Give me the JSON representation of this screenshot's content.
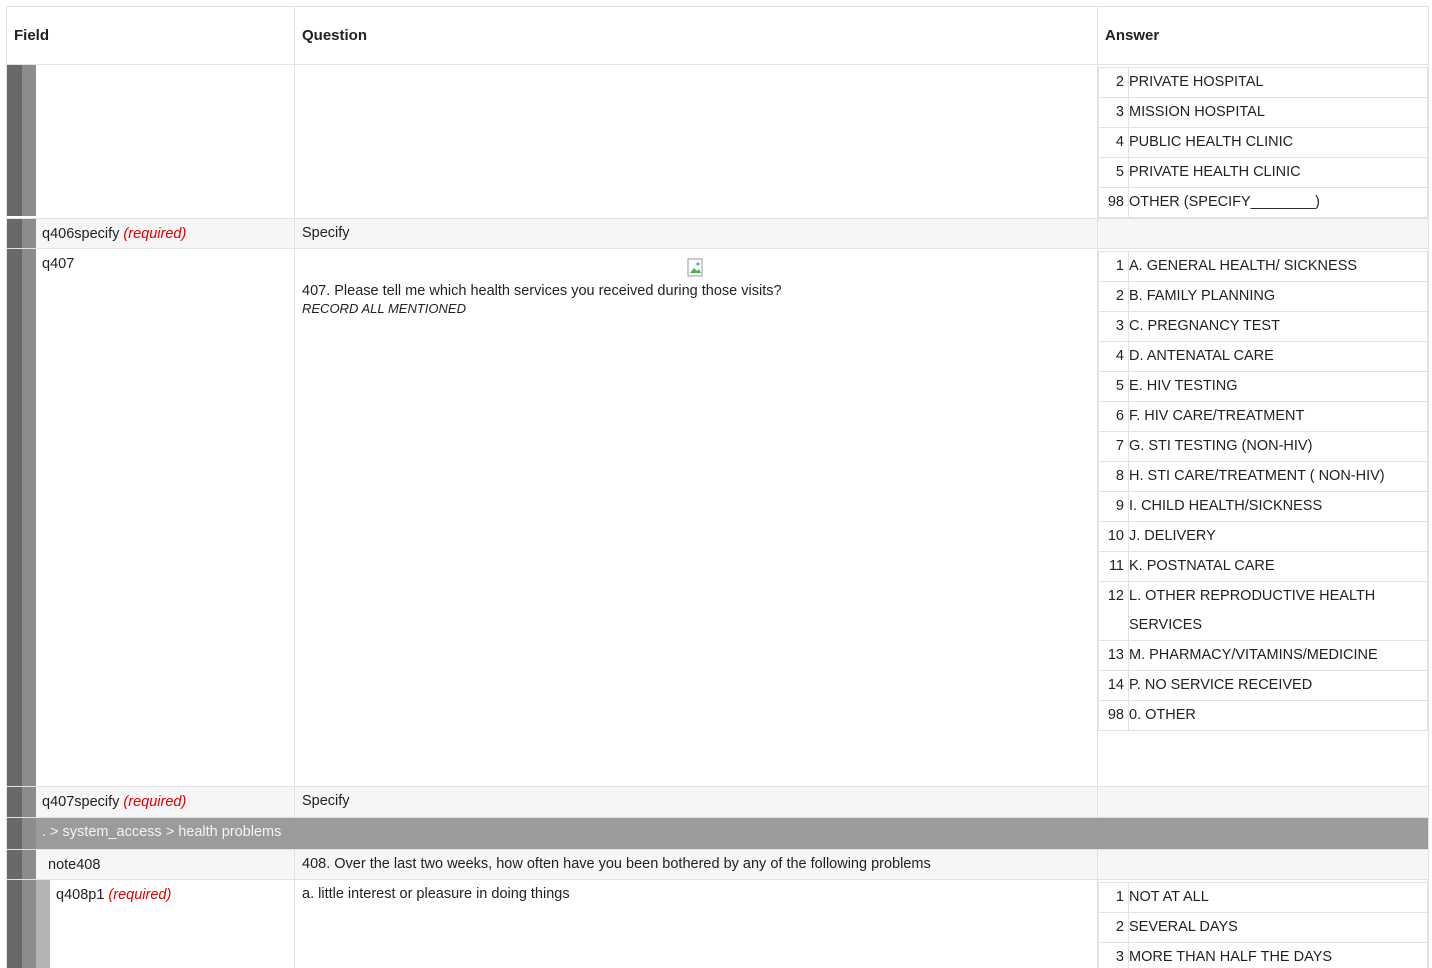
{
  "header": {
    "field": "Field",
    "question": "Question",
    "answer": "Answer"
  },
  "required_label": "(required)",
  "row_q406_cont": {
    "options": [
      {
        "code": "2",
        "label": "PRIVATE HOSPITAL"
      },
      {
        "code": "3",
        "label": "MISSION HOSPITAL"
      },
      {
        "code": "4",
        "label": "PUBLIC HEALTH CLINIC"
      },
      {
        "code": "5",
        "label": "PRIVATE HEALTH CLINIC"
      },
      {
        "code": "98",
        "label": "OTHER (SPECIFY________)"
      }
    ]
  },
  "row_q406specify": {
    "field": "q406specify",
    "question": "Specify"
  },
  "row_q407": {
    "field": "q407",
    "question": "407. Please tell me which health services you received during those visits?",
    "hint": "RECORD ALL MENTIONED",
    "options": [
      {
        "code": "1",
        "label": "A. GENERAL HEALTH/ SICKNESS"
      },
      {
        "code": "2",
        "label": "B. FAMILY PLANNING"
      },
      {
        "code": "3",
        "label": "C. PREGNANCY TEST"
      },
      {
        "code": "4",
        "label": "D. ANTENATAL CARE"
      },
      {
        "code": "5",
        "label": "E. HIV TESTING"
      },
      {
        "code": "6",
        "label": "F. HIV CARE/TREATMENT"
      },
      {
        "code": "7",
        "label": "G. STI TESTING (NON-HIV)"
      },
      {
        "code": "8",
        "label": "H. STI CARE/TREATMENT ( NON-HIV)"
      },
      {
        "code": "9",
        "label": "I. CHILD HEALTH/SICKNESS"
      },
      {
        "code": "10",
        "label": "J. DELIVERY"
      },
      {
        "code": "11",
        "label": "K. POSTNATAL CARE"
      },
      {
        "code": "12",
        "label": "L. OTHER REPRODUCTIVE HEALTH SERVICES"
      },
      {
        "code": "13",
        "label": "M. PHARMACY/VITAMINS/MEDICINE"
      },
      {
        "code": "14",
        "label": "P. NO SERVICE RECEIVED"
      },
      {
        "code": "98",
        "label": "0. OTHER"
      }
    ]
  },
  "row_q407specify": {
    "field": "q407specify",
    "question": "Specify"
  },
  "group": {
    "path": ". > system_access > health problems"
  },
  "row_note408": {
    "field": "note408",
    "question": "408. Over the last two weeks, how often have you been bothered by any of the following problems"
  },
  "row_q408p1": {
    "field": "q408p1",
    "question": "a. little interest or pleasure in doing things",
    "options": [
      {
        "code": "1",
        "label": "NOT AT ALL"
      },
      {
        "code": "2",
        "label": "SEVERAL DAYS"
      },
      {
        "code": "3",
        "label": "MORE THAN HALF THE DAYS"
      }
    ]
  }
}
